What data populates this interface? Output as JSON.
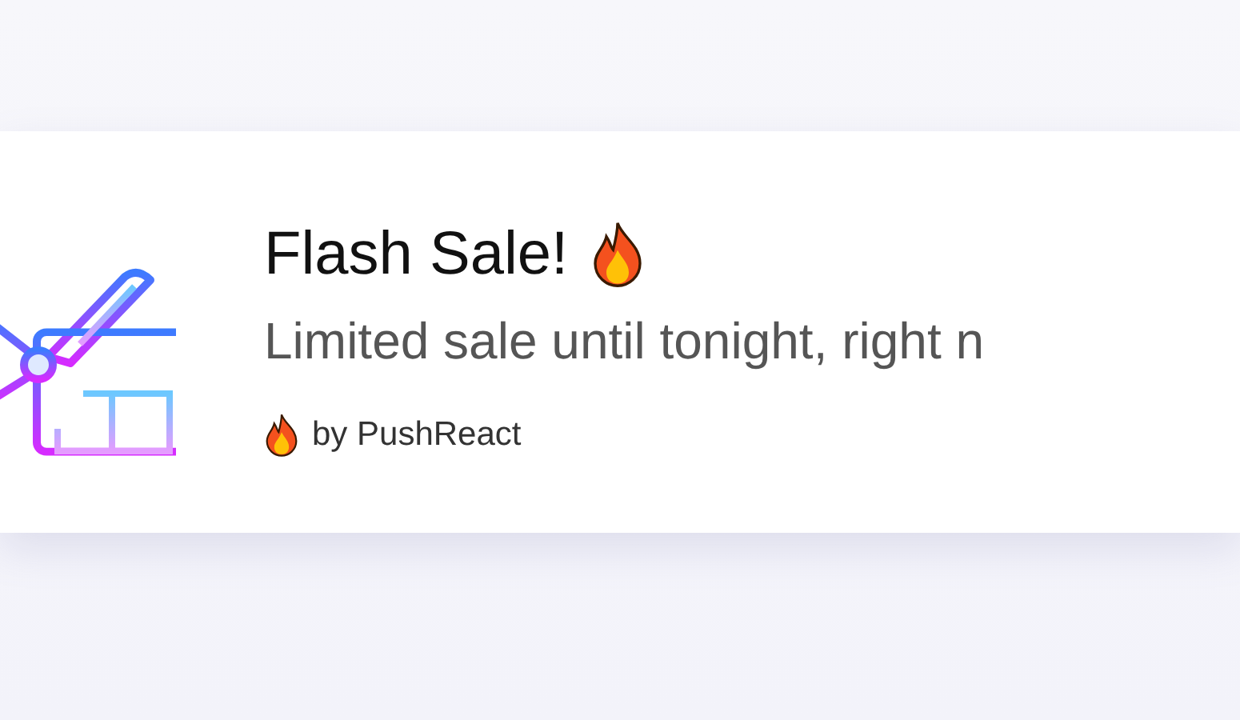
{
  "notification": {
    "title": "Flash Sale!",
    "message": "Limited sale until tonight, right n",
    "attribution": "by PushReact"
  }
}
